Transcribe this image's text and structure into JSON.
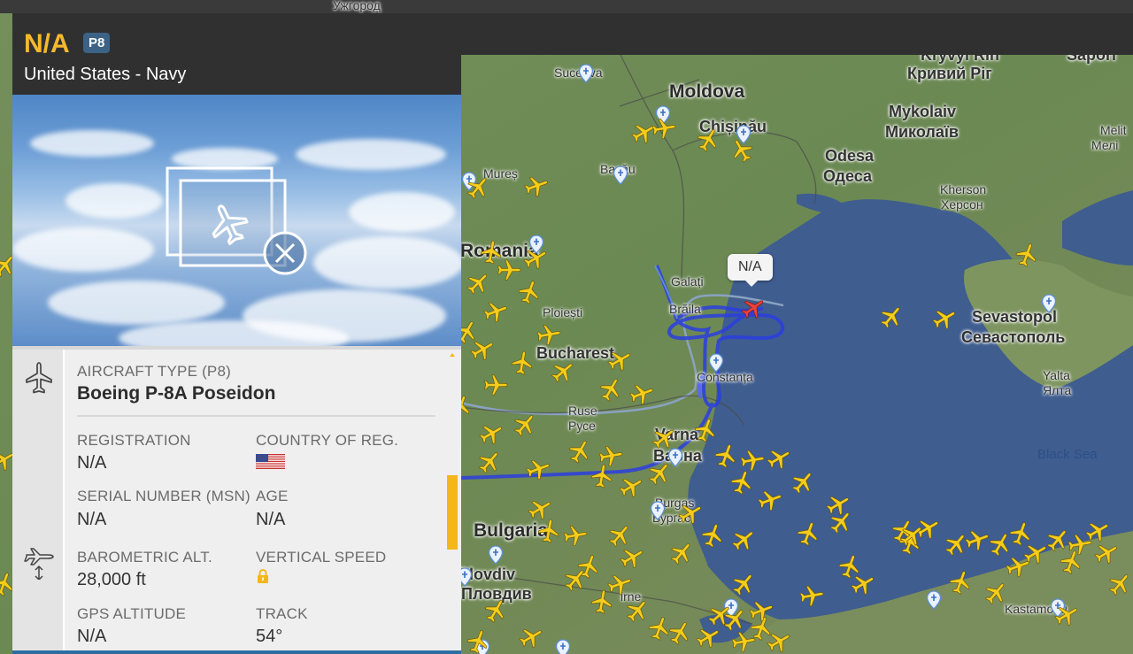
{
  "panel": {
    "callsign": "N/A",
    "type_badge": "P8",
    "operator": "United States - Navy",
    "aircraft_type_label": "AIRCRAFT TYPE",
    "aircraft_type_code": "(P8)",
    "aircraft_model": "Boeing P-8A Poseidon",
    "fields": {
      "registration_label": "REGISTRATION",
      "registration_value": "N/A",
      "country_label": "COUNTRY OF REG.",
      "serial_label": "SERIAL NUMBER (MSN)",
      "serial_value": "N/A",
      "age_label": "AGE",
      "age_value": "N/A",
      "baro_alt_label": "BAROMETRIC ALT.",
      "baro_alt_value": "28,000 ft",
      "vspeed_label": "VERTICAL SPEED",
      "gps_alt_label": "GPS ALTITUDE",
      "gps_alt_value": "N/A",
      "track_label": "TRACK",
      "track_value": "54°"
    },
    "icons": [
      "aircraft-type-icon",
      "altitude-icon",
      "no-photo-icon",
      "us-flag-icon",
      "lock-icon"
    ]
  },
  "map": {
    "target_label": "N/A",
    "labels": [
      {
        "key": "uzhhorod",
        "text": "Ужгород"
      },
      {
        "key": "kryvyi_rih_en",
        "text": "Kryvyi Rih"
      },
      {
        "key": "kryvyi_rih_uk",
        "text": "Кривий Ріг"
      },
      {
        "key": "saporizhzhia",
        "text": "Sapori"
      },
      {
        "key": "moldova",
        "text": "Moldova"
      },
      {
        "key": "suceava",
        "text": "Suceava"
      },
      {
        "key": "chisinau",
        "text": "Chișinău"
      },
      {
        "key": "mykolaiv_en",
        "text": "Mykolaiv"
      },
      {
        "key": "mykolaiv_uk",
        "text": "Миколаїв"
      },
      {
        "key": "melit_en",
        "text": "Melit"
      },
      {
        "key": "melit_uk",
        "text": "Мелі"
      },
      {
        "key": "odesa_en",
        "text": "Odesa"
      },
      {
        "key": "odesa_uk",
        "text": "Одеса"
      },
      {
        "key": "kherson_en",
        "text": "Kherson"
      },
      {
        "key": "kherson_uk",
        "text": "Херсон"
      },
      {
        "key": "mures",
        "text": "Mureș"
      },
      {
        "key": "bacau",
        "text": "Bacău"
      },
      {
        "key": "romania",
        "text": "Romania"
      },
      {
        "key": "galati",
        "text": "Galați"
      },
      {
        "key": "braila",
        "text": "Brăila"
      },
      {
        "key": "ploiesti",
        "text": "Ploiești"
      },
      {
        "key": "bucharest",
        "text": "Bucharest"
      },
      {
        "key": "constanta",
        "text": "Constanța"
      },
      {
        "key": "sevastopol_en",
        "text": "Sevastopol"
      },
      {
        "key": "sevastopol_uk",
        "text": "Севастополь"
      },
      {
        "key": "yalta_en",
        "text": "Yalta"
      },
      {
        "key": "yalta_uk",
        "text": "Ялта"
      },
      {
        "key": "ruse_en",
        "text": "Ruse"
      },
      {
        "key": "ruse_bg",
        "text": "Русе"
      },
      {
        "key": "varna_en",
        "text": "Varna"
      },
      {
        "key": "varna_bg",
        "text": "Варна"
      },
      {
        "key": "black_sea",
        "text": "Black Sea"
      },
      {
        "key": "burgas_en",
        "text": "Burgas"
      },
      {
        "key": "burgas_bg",
        "text": "Бургас"
      },
      {
        "key": "bulgaria",
        "text": "Bulgaria"
      },
      {
        "key": "plovdiv_en",
        "text": "Plovdiv"
      },
      {
        "key": "plovdiv_bg",
        "text": "Пловдив"
      },
      {
        "key": "edirne",
        "text": "irne"
      },
      {
        "key": "kastamonu",
        "text": "Kastamonu"
      }
    ],
    "colors": {
      "land": "#6f8c57",
      "sea": "#3d5c8f",
      "target_plane": "#e8423c",
      "traffic_plane": "#f4cc1b",
      "track_line": "#2b3ee0",
      "callsign": "#f6b92d",
      "badge": "#3c6386",
      "scroll_thumb": "#f5b61a"
    }
  }
}
